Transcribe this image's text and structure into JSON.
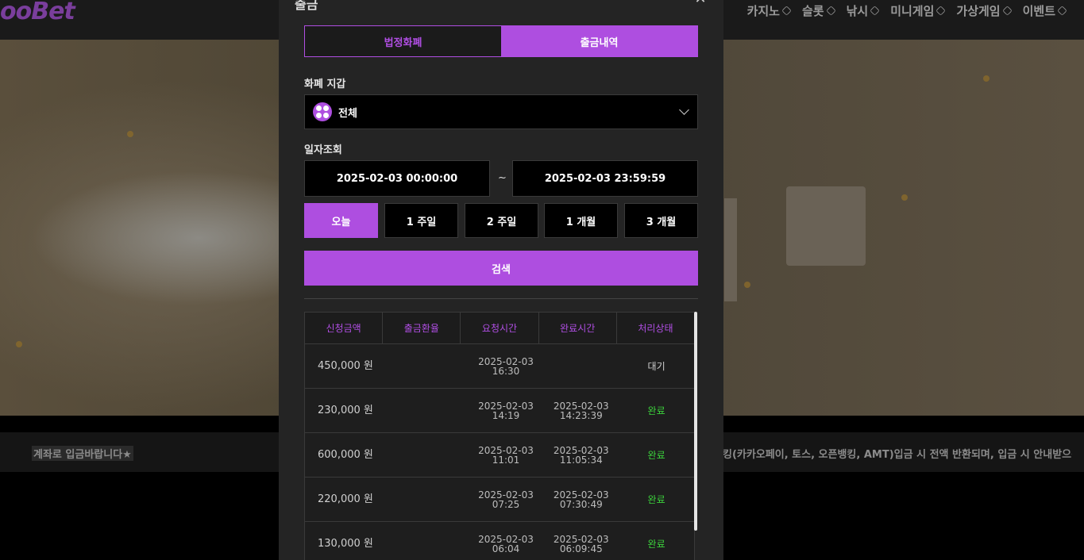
{
  "site": {
    "logo": "ooBet",
    "nav": [
      "카지노",
      "슬롯",
      "낚시",
      "미니게임",
      "가상게임",
      "이벤트"
    ],
    "ticker_left": "계좌로 입금바랍니다★",
    "ticker_right": "킹(카카오페이, 토스, 오픈뱅킹, AMT)입금 시 전액 반환되며, 입금 시 안내받으신"
  },
  "modal": {
    "title": "출금",
    "close_icon": "close-icon",
    "tabs": [
      {
        "label": "법정화폐",
        "active": false
      },
      {
        "label": "출금내역",
        "active": true
      }
    ],
    "wallet_label": "화폐 지갑",
    "wallet_value": "전체",
    "date_label": "일자조회",
    "date_from": "2025-02-03 00:00:00",
    "date_sep": "~",
    "date_to": "2025-02-03 23:59:59",
    "quick": [
      {
        "label": "오늘",
        "active": true
      },
      {
        "label": "1 주일",
        "active": false
      },
      {
        "label": "2 주일",
        "active": false
      },
      {
        "label": "1 개월",
        "active": false
      },
      {
        "label": "3 개월",
        "active": false
      }
    ],
    "search_label": "검색",
    "table": {
      "headers": [
        "신청금액",
        "출금환율",
        "요청시간",
        "완료시간",
        "처리상태"
      ],
      "rows": [
        {
          "amount": "450,000 원",
          "rate": "",
          "requested": "2025-02-03\n16:30",
          "completed": "",
          "status": "대기",
          "status_kind": "wait"
        },
        {
          "amount": "230,000 원",
          "rate": "",
          "requested": "2025-02-03\n14:19",
          "completed": "2025-02-03\n14:23:39",
          "status": "완료",
          "status_kind": "done"
        },
        {
          "amount": "600,000 원",
          "rate": "",
          "requested": "2025-02-03\n11:01",
          "completed": "2025-02-03\n11:05:34",
          "status": "완료",
          "status_kind": "done"
        },
        {
          "amount": "220,000 원",
          "rate": "",
          "requested": "2025-02-03\n07:25",
          "completed": "2025-02-03\n07:30:49",
          "status": "완료",
          "status_kind": "done"
        },
        {
          "amount": "130,000 원",
          "rate": "",
          "requested": "2025-02-03\n06:04",
          "completed": "2025-02-03\n06:09:45",
          "status": "완료",
          "status_kind": "done"
        }
      ]
    }
  },
  "colors": {
    "accent": "#ae4ee0",
    "done": "#3cd33c"
  }
}
